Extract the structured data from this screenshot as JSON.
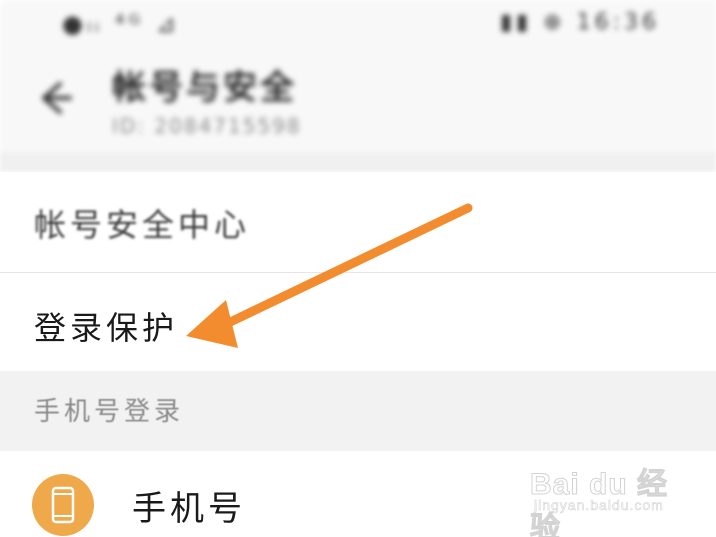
{
  "header": {
    "title": "帐号与安全",
    "subtitle": "ID: 2084715598"
  },
  "status_bar": {
    "left": "●ₗᵢ ⁴ᴳ ⊿",
    "right": "▮▮ ⊕ 16:36"
  },
  "menu": {
    "account_security_center": "帐号安全中心",
    "login_protection": "登录保护"
  },
  "phone_login_section": {
    "header": "手机号登录",
    "phone_item_label": "手机号"
  },
  "watermark": {
    "brand": "Bai du 经验",
    "url": "jingyan.baidu.com"
  },
  "colors": {
    "arrow": "#f28c2e",
    "phone_icon_bg": "#f0a94a"
  }
}
